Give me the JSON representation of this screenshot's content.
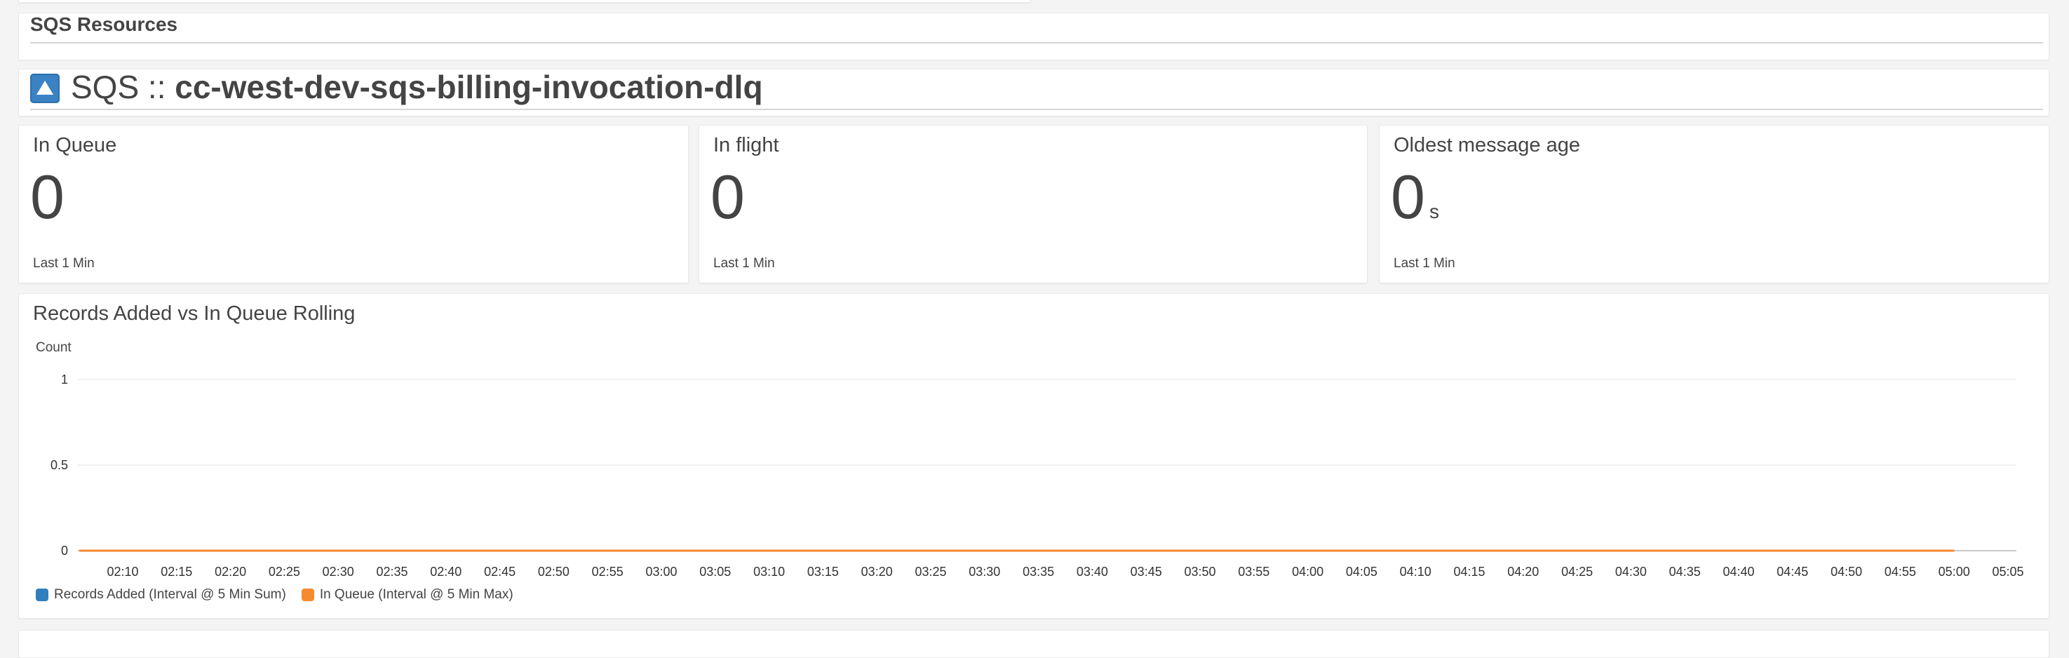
{
  "sections": {
    "resources_title": "SQS Resources",
    "queue_prefix": "SQS ::",
    "queue_name": "cc-west-dev-sqs-billing-invocation-dlq"
  },
  "metrics": [
    {
      "title": "In Queue",
      "value": "0",
      "unit": "",
      "period": "Last 1 Min"
    },
    {
      "title": "In flight",
      "value": "0",
      "unit": "",
      "period": "Last 1 Min"
    },
    {
      "title": "Oldest message age",
      "value": "0",
      "unit": "s",
      "period": "Last 1 Min"
    }
  ],
  "chart": {
    "title": "Records Added vs In Queue Rolling",
    "ylabel": "Count"
  },
  "colors": {
    "series_blue": "#2f7ebd",
    "series_orange": "#f58a2e",
    "sqs_icon": "#3b82c4"
  },
  "chart_data": {
    "type": "line",
    "title": "Records Added vs In Queue Rolling",
    "ylabel": "Count",
    "xlabel": "",
    "ylim": [
      0,
      1
    ],
    "yticks": [
      "1",
      "0.5",
      "0"
    ],
    "x": [
      "02:10",
      "02:15",
      "02:20",
      "02:25",
      "02:30",
      "02:35",
      "02:40",
      "02:45",
      "02:50",
      "02:55",
      "03:00",
      "03:05",
      "03:10",
      "03:15",
      "03:20",
      "03:25",
      "03:30",
      "03:35",
      "03:40",
      "03:45",
      "03:50",
      "03:55",
      "04:00",
      "04:05",
      "04:10",
      "04:15",
      "04:20",
      "04:25",
      "04:30",
      "04:35",
      "04:40",
      "04:45",
      "04:50",
      "04:55",
      "05:00",
      "05:05"
    ],
    "series": [
      {
        "name": "Records Added (Interval @ 5 Min Sum)",
        "color": "#2f7ebd",
        "values": [
          0,
          0,
          0,
          0,
          0,
          0,
          0,
          0,
          0,
          0,
          0,
          0,
          0,
          0,
          0,
          0,
          0,
          0,
          0,
          0,
          0,
          0,
          0,
          0,
          0,
          0,
          0,
          0,
          0,
          0,
          0,
          0,
          0,
          0,
          0
        ]
      },
      {
        "name": "In Queue (Interval @ 5 Min Max)",
        "color": "#f58a2e",
        "values": [
          0,
          0,
          0,
          0,
          0,
          0,
          0,
          0,
          0,
          0,
          0,
          0,
          0,
          0,
          0,
          0,
          0,
          0,
          0,
          0,
          0,
          0,
          0,
          0,
          0,
          0,
          0,
          0,
          0,
          0,
          0,
          0,
          0,
          0,
          0
        ]
      }
    ],
    "grid": true,
    "legend": "bottom-left"
  }
}
